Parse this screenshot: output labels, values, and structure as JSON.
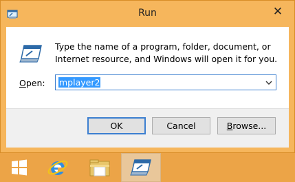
{
  "window": {
    "title": "Run",
    "close_glyph": "✕",
    "title_icon": "run-icon"
  },
  "dialog": {
    "description": "Type the name of a program, folder, document, or Internet resource, and Windows will open it for you.",
    "open_label_accel": "O",
    "open_label_rest": "pen:",
    "open_value": "mplayer2",
    "icon": "run-icon"
  },
  "buttons": {
    "ok": "OK",
    "cancel": "Cancel",
    "browse_accel": "B",
    "browse_rest": "rowse..."
  },
  "taskbar": {
    "items": [
      "start-icon",
      "internet-explorer-icon",
      "file-explorer-icon",
      "run-icon"
    ],
    "active": "run-icon"
  },
  "colors": {
    "frame": "#f6b65c",
    "taskbar": "#eca447",
    "selection": "#3399ff",
    "focus_border": "#3c7fd0"
  }
}
